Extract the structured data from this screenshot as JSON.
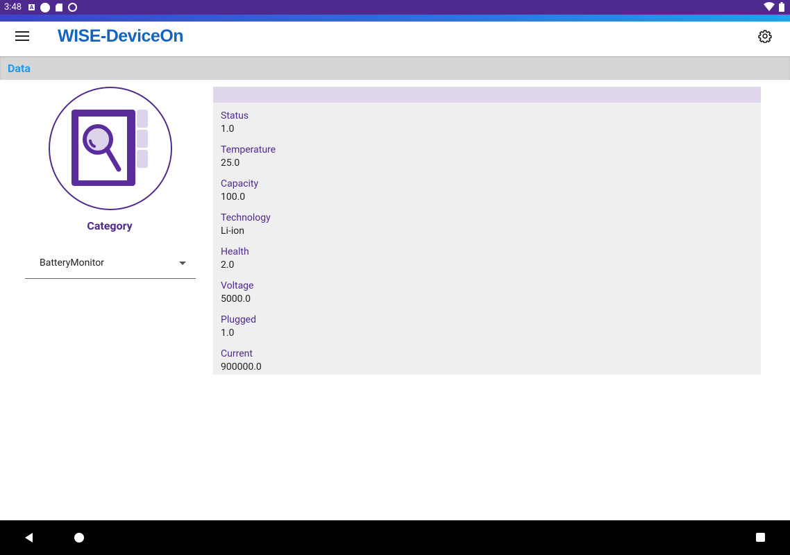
{
  "status_bar": {
    "time": "3:48",
    "icons": [
      "keyboard-a-icon",
      "circle-icon",
      "sd-card-icon",
      "sync-icon",
      "wifi-icon",
      "battery-icon"
    ]
  },
  "app": {
    "brand": "WISE-DeviceOn",
    "menu_icon": "hamburger-menu-icon",
    "settings_icon": "gear-icon"
  },
  "section": {
    "title": "Data"
  },
  "category": {
    "icon": "magnifier-document-icon",
    "title": "Category",
    "selected": "BatteryMonitor"
  },
  "data_rows": [
    {
      "label": "Status",
      "value": "1.0"
    },
    {
      "label": "Temperature",
      "value": "25.0"
    },
    {
      "label": "Capacity",
      "value": "100.0"
    },
    {
      "label": "Technology",
      "value": "Li-ion"
    },
    {
      "label": "Health",
      "value": "2.0"
    },
    {
      "label": "Voltage",
      "value": "5000.0"
    },
    {
      "label": "Plugged",
      "value": "1.0"
    },
    {
      "label": "Current",
      "value": "900000.0"
    }
  ],
  "colors": {
    "status_bar": "#4e2a8e",
    "brand": "#1565c0",
    "section_title": "#1e9be8",
    "primary_purple": "#4e2a8e",
    "icon_light_purple": "#ddd4ec",
    "data_header": "#e1d7ea"
  }
}
